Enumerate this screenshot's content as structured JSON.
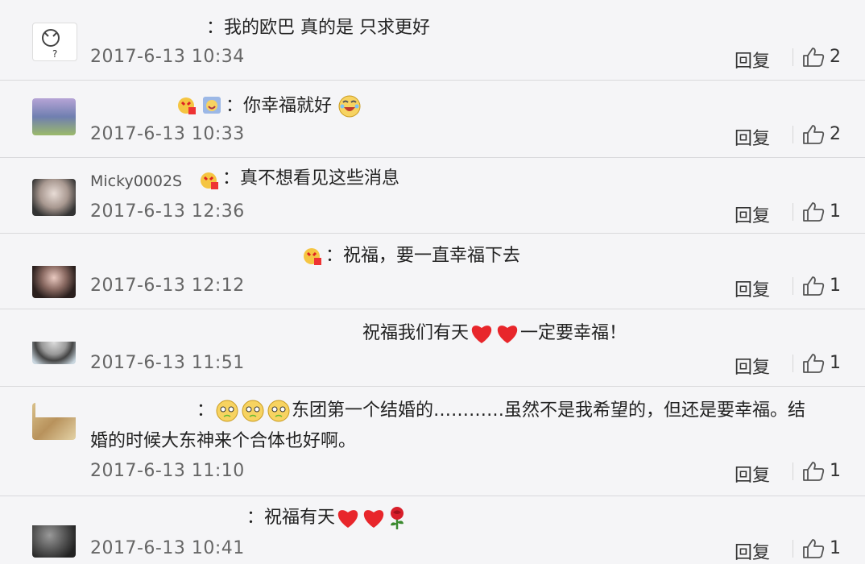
{
  "comments": [
    {
      "text": "：我的欧巴 真的是 只求更好",
      "date": "2017-6-13 10:34",
      "reply": "回复",
      "likes": "2"
    },
    {
      "text": "：你幸福就好",
      "date": "2017-6-13 10:33",
      "reply": "回复",
      "likes": "2"
    },
    {
      "user": "Micky0002S",
      "text": "：真不想看见这些消息",
      "date": "2017-6-13 12:36",
      "reply": "回复",
      "likes": "1"
    },
    {
      "text": "：祝福，要一直幸福下去",
      "date": "2017-6-13 12:12",
      "reply": "回复",
      "likes": "1"
    },
    {
      "text_a": "祝福我们有天",
      "text_b": "一定要幸福！",
      "date": "2017-6-13 11:51",
      "reply": "回复",
      "likes": "1"
    },
    {
      "prefix": "：",
      "line1": "东团第一个结婚的…………虽然不是我希望的，但还是要幸福。结",
      "line2": "婚的时候大东神来个合体也好啊。",
      "date": "2017-6-13 11:10",
      "reply": "回复",
      "likes": "1"
    },
    {
      "text": "：祝福有天",
      "date": "2017-6-13 10:41",
      "reply": "回复",
      "likes": "1"
    }
  ]
}
